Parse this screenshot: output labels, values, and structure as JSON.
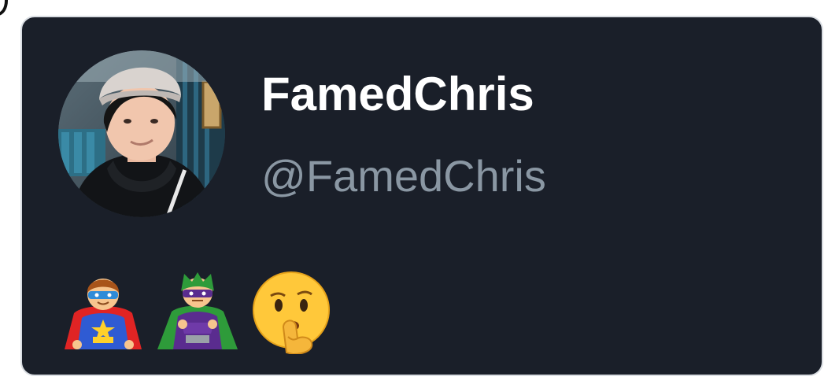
{
  "profile": {
    "display_name": "FamedChris",
    "handle": "@FamedChris"
  },
  "emojis": [
    {
      "name": "superhero-man-icon"
    },
    {
      "name": "supervillain-man-icon"
    },
    {
      "name": "shushing-face-icon"
    }
  ],
  "colors": {
    "card_background": "#1a1f29",
    "card_border": "#d9dde2",
    "display_name": "#ffffff",
    "handle": "#8a97a3",
    "page_background": "#ffffff"
  }
}
